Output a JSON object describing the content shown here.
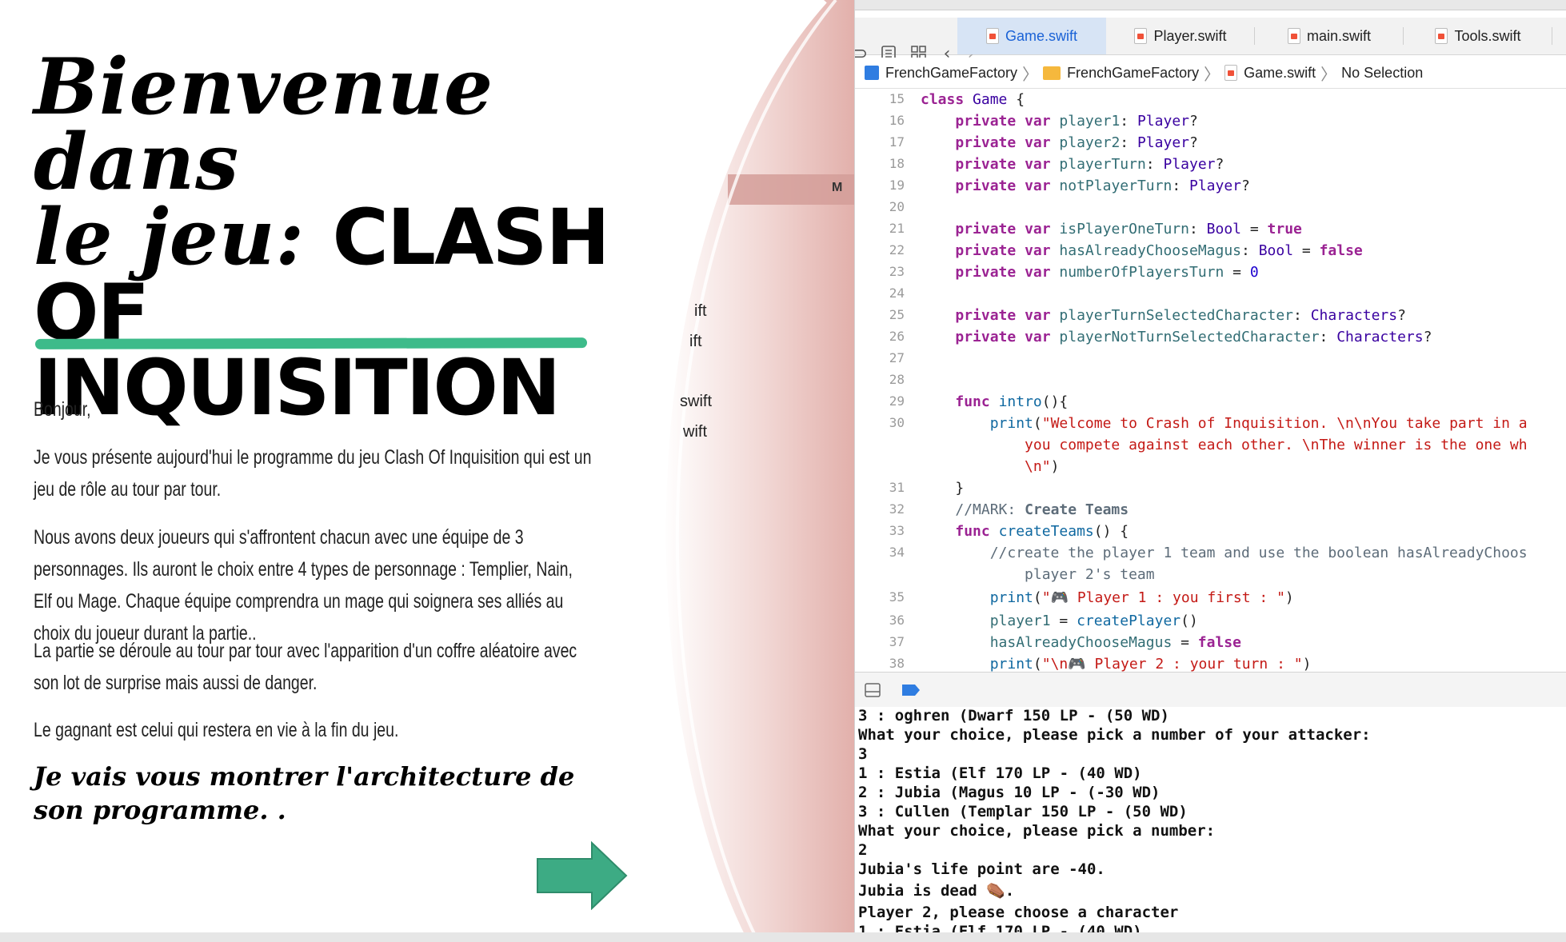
{
  "slide": {
    "title_line1": "Bienvenue dans",
    "title_line2_a": "le jeu: ",
    "title_line2_b": "CLASH OF",
    "title_line3": "INQUISITION",
    "paragraphs": [
      "Bonjour,",
      "Je vous présente aujourd'hui le programme du jeu Clash Of Inquisition qui est un jeu de rôle au tour par tour.",
      "Nous avons deux joueurs qui s'affrontent chacun avec une équipe de 3 personnages. Ils auront le choix entre 4 types de personnage : Templier, Nain, Elf ou Mage.  Chaque équipe comprendra un mage qui soignera ses alliés au choix du joueur durant la partie..",
      "La partie se déroule au tour par tour avec l'apparition d'un coffre aléatoire avec son lot de surprise mais aussi de danger.",
      "Le gagnant est celui qui restera en vie à la fin du jeu."
    ],
    "closing": "Je vais vous montrer l'architecture de son programme. .",
    "accent_color": "#3dbb8a",
    "arrow_icon": "right-arrow-icon"
  },
  "partial_navigator": {
    "badge": "M",
    "items": [
      "ift",
      "ift",
      "swift",
      "wift"
    ]
  },
  "xcode": {
    "tabs": [
      {
        "label": "Game.swift",
        "active": true
      },
      {
        "label": "Player.swift",
        "active": false
      },
      {
        "label": "main.swift",
        "active": false
      },
      {
        "label": "Tools.swift",
        "active": false
      }
    ],
    "breadcrumb": [
      "FrenchGameFactory",
      "FrenchGameFactory",
      "Game.swift",
      "No Selection"
    ],
    "code_lines": [
      {
        "n": "15"
      },
      {
        "n": "16"
      },
      {
        "n": "17"
      },
      {
        "n": "18"
      },
      {
        "n": "19"
      },
      {
        "n": "20"
      },
      {
        "n": "21"
      },
      {
        "n": "22"
      },
      {
        "n": "23"
      },
      {
        "n": "24"
      },
      {
        "n": "25"
      },
      {
        "n": "26"
      },
      {
        "n": "27"
      },
      {
        "n": "28"
      },
      {
        "n": "29"
      },
      {
        "n": "30"
      },
      {
        "n": "31"
      },
      {
        "n": "32"
      },
      {
        "n": "33"
      },
      {
        "n": "34"
      },
      {
        "n": "35"
      },
      {
        "n": "36"
      },
      {
        "n": "37"
      },
      {
        "n": "38"
      }
    ],
    "console_lines": [
      "3 : oghren (Dwarf 150 LP - (50 WD)",
      "What your choice, please pick a number of your attacker:",
      "3",
      "1 : Estia (Elf 170 LP - (40 WD)",
      "2 : Jubia (Magus 10 LP - (-30 WD)",
      "3 : Cullen (Templar 150 LP - (50 WD)",
      "What your choice, please pick a number:",
      "2",
      "Jubia's life point are -40.",
      "Jubia is dead ⚰️.",
      "Player 2, please choose a character",
      "1 : Estia (Elf 170 LP - (40 WD)"
    ]
  }
}
